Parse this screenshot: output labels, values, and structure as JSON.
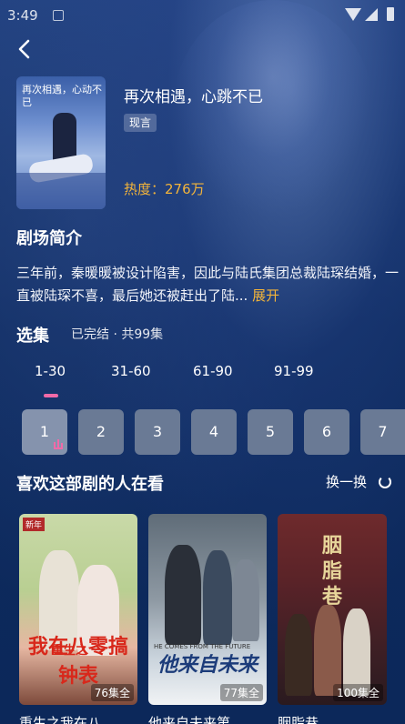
{
  "status_bar": {
    "time": "3:49"
  },
  "drama": {
    "poster_text": "再次相遇，心动不已",
    "title": "再次相遇，心跳不已",
    "tag": "现言",
    "heat": "热度：276万"
  },
  "intro": {
    "heading": "剧场简介",
    "text": "三年前，秦暖暖被设计陷害，因此与陆氏集团总裁陆琛结婚，一直被陆琛不喜，最后她还被赶出了陆...",
    "expand": "展开"
  },
  "episodes": {
    "heading": "选集",
    "status": "已完结 · 共99集",
    "ranges": [
      "1-30",
      "31-60",
      "61-90",
      "91-99"
    ],
    "items": [
      "1",
      "2",
      "3",
      "4",
      "5",
      "6",
      "7"
    ]
  },
  "recommend": {
    "heading": "喜欢这部剧的人在看",
    "refresh": "换一换",
    "cards": [
      {
        "poster_big": "我在八零搞钟表",
        "poster_sub": "重生之",
        "poster_label": "新年",
        "count": "76集全",
        "title": "重生之我在八"
      },
      {
        "poster_big": "他来自未来",
        "poster_en": "HE COMES FROM THE FUTURE",
        "count": "77集全",
        "title": "他来自未来第"
      },
      {
        "poster_big": "胭脂巷",
        "count": "100集全",
        "title": "胭脂巷"
      }
    ]
  },
  "colors": {
    "accent": "#f3b43a",
    "indicator": "#f06aa8",
    "background": "#0d2a5e"
  }
}
